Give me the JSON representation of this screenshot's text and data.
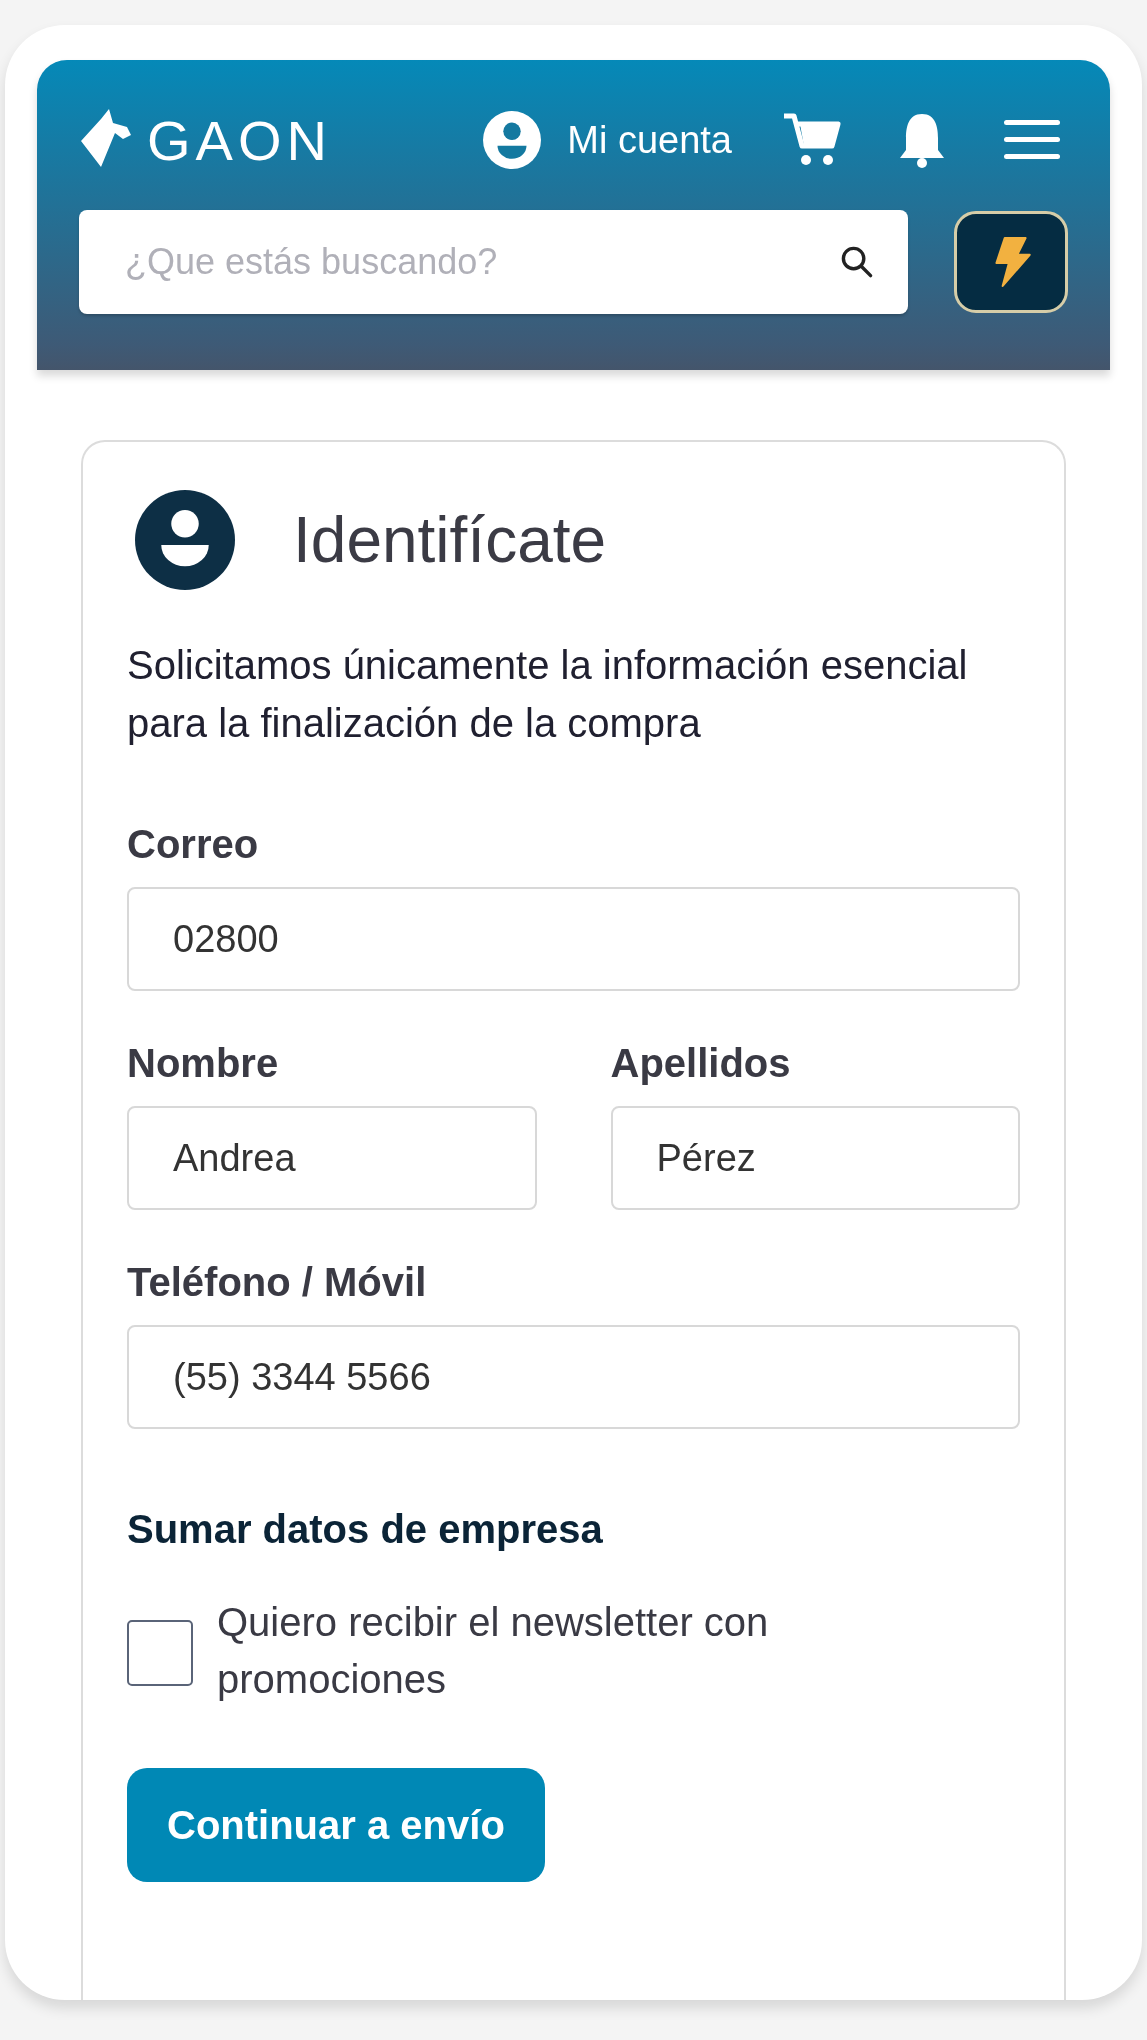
{
  "header": {
    "logo": "GAON",
    "account": "Mi cuenta",
    "search": {
      "placeholder": "¿Que estás buscando?"
    }
  },
  "card": {
    "title": "Identifícate",
    "description": "Solicitamos únicamente la información esencial para la finalización de la compra",
    "fields": [
      {
        "label": "Correo",
        "value": "02800",
        "kind": "full"
      },
      {
        "label": "Nombre",
        "value": "Andrea",
        "kind": "half"
      },
      {
        "label": "Apellidos",
        "value": "Pérez",
        "kind": "half"
      },
      {
        "label": "Teléfono / Móvil",
        "value": "(55) 3344 5566",
        "kind": "full"
      }
    ],
    "section": "Sumar datos de empresa",
    "newsletter": {
      "label": "Quiero recibir el newsletter con promociones",
      "checked": false
    },
    "button": "Continuar a envío"
  }
}
